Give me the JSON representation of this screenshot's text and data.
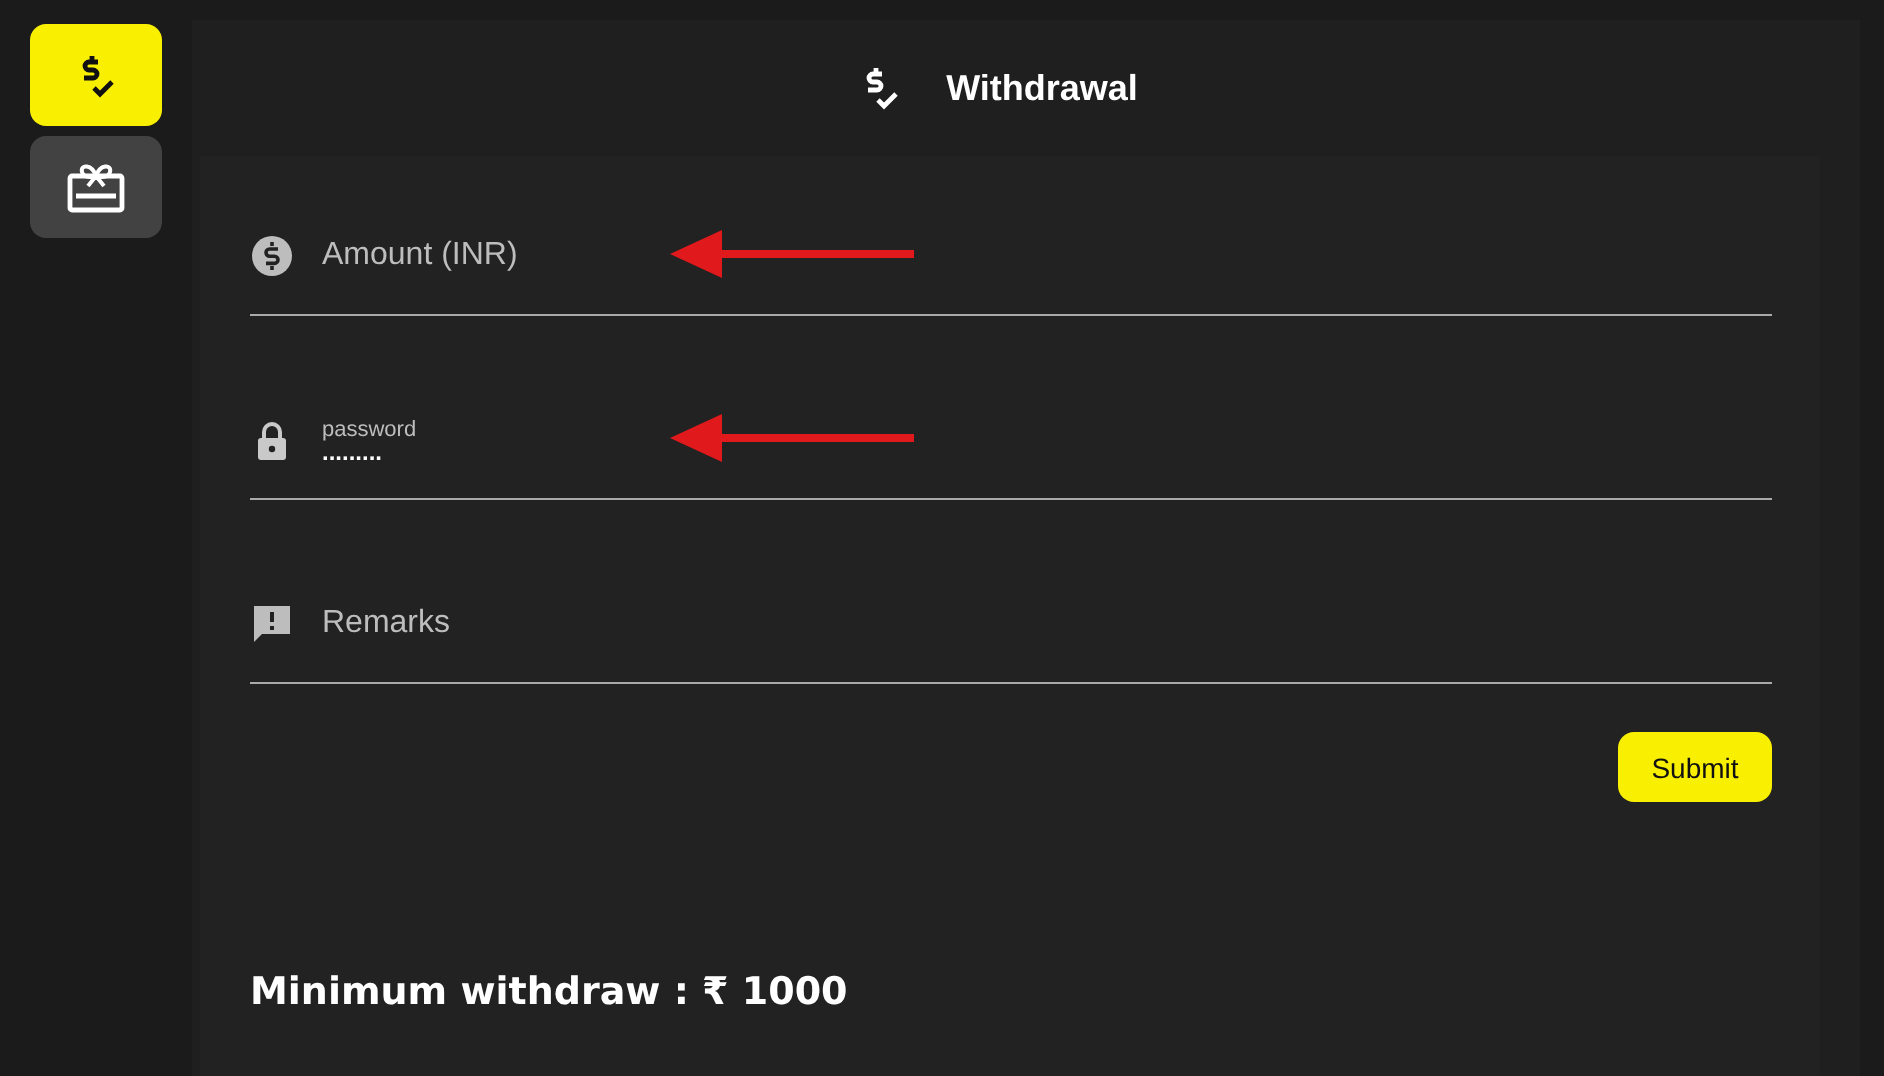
{
  "sidebar": {
    "items": [
      {
        "kind": "withdraw",
        "selected": true
      },
      {
        "kind": "gift",
        "selected": false
      }
    ]
  },
  "header": {
    "title": "Withdrawal"
  },
  "fields": [
    {
      "kind": "amount",
      "placeholder": "Amount (INR)",
      "marked": true
    },
    {
      "kind": "password",
      "label": "password",
      "value": ".........",
      "marked": true
    },
    {
      "kind": "remarks",
      "placeholder": "Remarks",
      "marked": false
    }
  ],
  "submit": "Submit",
  "note": "Minimum withdraw : ₹ 1000"
}
